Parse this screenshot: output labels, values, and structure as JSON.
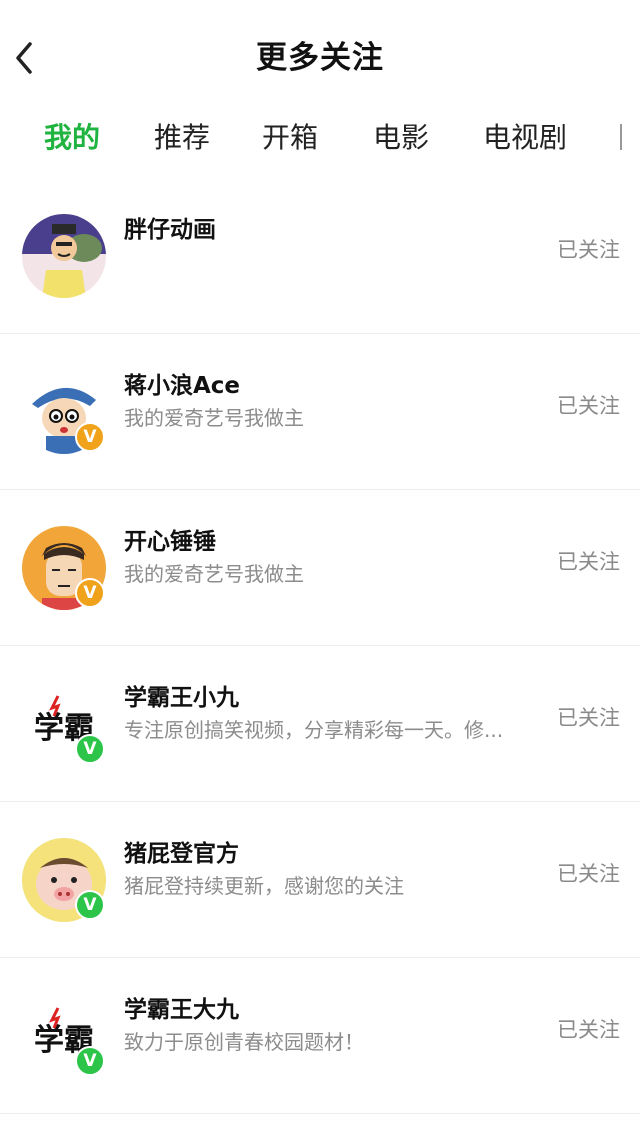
{
  "header": {
    "title": "更多关注",
    "back_icon": "chevron-left-icon"
  },
  "tabs": [
    {
      "label": "我的",
      "active": true
    },
    {
      "label": "推荐",
      "active": false
    },
    {
      "label": "开箱",
      "active": false
    },
    {
      "label": "电影",
      "active": false
    },
    {
      "label": "电视剧",
      "active": false
    }
  ],
  "colors": {
    "accent": "#1fb33f",
    "badge_gold": "#f0a21b",
    "badge_green": "#2cc54a"
  },
  "follows": [
    {
      "name": "胖仔动画",
      "desc": "",
      "status": "已关注",
      "badge": ""
    },
    {
      "name": "蒋小浪Ace",
      "desc": "我的爱奇艺号我做主",
      "status": "已关注",
      "badge": "V"
    },
    {
      "name": "开心锤锤",
      "desc": "我的爱奇艺号我做主",
      "status": "已关注",
      "badge": "V"
    },
    {
      "name": "学霸王小九",
      "desc": "专注原创搞笑视频，分享精彩每一天。修...",
      "status": "已关注",
      "badge": "V"
    },
    {
      "name": "猪屁登官方",
      "desc": "猪屁登持续更新，感谢您的关注",
      "status": "已关注",
      "badge": "V"
    },
    {
      "name": "学霸王大九",
      "desc": "致力于原创青春校园题材！",
      "status": "已关注",
      "badge": "V"
    }
  ],
  "avatar_art": {
    "xueba_text": "学霸"
  }
}
